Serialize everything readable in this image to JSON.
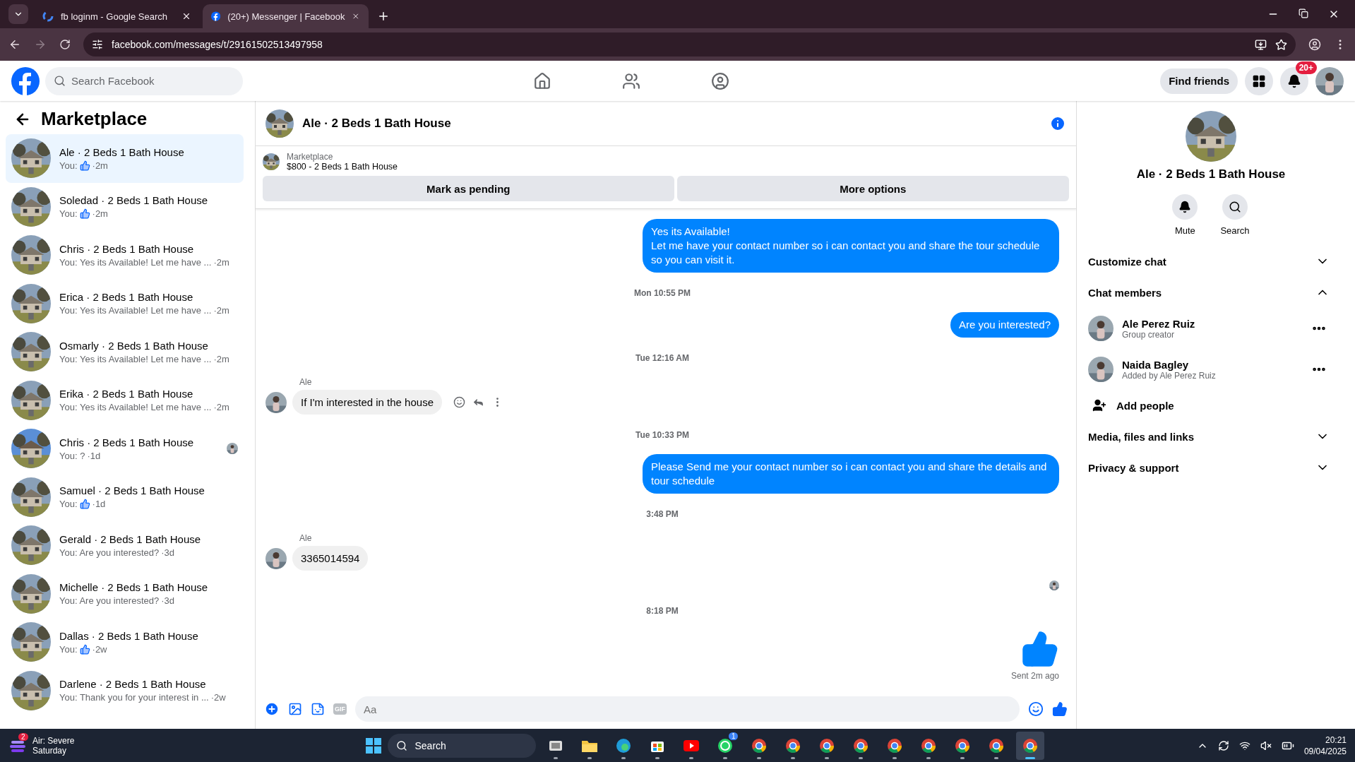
{
  "browser": {
    "tabs": [
      {
        "title": "fb loginm - Google Search",
        "selected": false
      },
      {
        "title": "(20+) Messenger | Facebook",
        "selected": true
      }
    ],
    "url": "facebook.com/messages/t/29161502513497958"
  },
  "header": {
    "search_placeholder": "Search Facebook",
    "find_friends": "Find friends",
    "notification_badge": "20+"
  },
  "sidebar": {
    "title": "Marketplace",
    "conversations": [
      {
        "name": "Ale · 2 Beds 1 Bath House",
        "preview": "You:",
        "kind": "like",
        "time": "·2m",
        "selected": true,
        "seen_avatar": false
      },
      {
        "name": "Soledad · 2 Beds 1 Bath House",
        "preview": "You:",
        "kind": "like",
        "time": "·2m",
        "selected": false,
        "seen_avatar": false
      },
      {
        "name": "Chris · 2 Beds 1 Bath House",
        "preview": "You: Yes its Available! Let me have ...",
        "kind": "text",
        "time": "·2m",
        "selected": false,
        "seen_avatar": false
      },
      {
        "name": "Erica · 2 Beds 1 Bath House",
        "preview": "You: Yes its Available! Let me have ...",
        "kind": "text",
        "time": "·2m",
        "selected": false,
        "seen_avatar": false
      },
      {
        "name": "Osmarly · 2 Beds 1 Bath House",
        "preview": "You: Yes its Available! Let me have ...",
        "kind": "text",
        "time": "·2m",
        "selected": false,
        "seen_avatar": false
      },
      {
        "name": "Erika · 2 Beds 1 Bath House",
        "preview": "You: Yes its Available! Let me have ...",
        "kind": "text",
        "time": "·2m",
        "selected": false,
        "seen_avatar": false
      },
      {
        "name": "Chris · 2 Beds 1 Bath House",
        "preview": "You: ?",
        "kind": "text",
        "time": "·1d",
        "selected": false,
        "seen_avatar": true
      },
      {
        "name": "Samuel · 2 Beds 1 Bath House",
        "preview": "You:",
        "kind": "like",
        "time": "·1d",
        "selected": false,
        "seen_avatar": false
      },
      {
        "name": "Gerald · 2 Beds 1 Bath House",
        "preview": "You: Are you interested?",
        "kind": "text",
        "time": "·3d",
        "selected": false,
        "seen_avatar": false
      },
      {
        "name": "Michelle · 2 Beds 1 Bath House",
        "preview": "You: Are you interested?",
        "kind": "text",
        "time": "·3d",
        "selected": false,
        "seen_avatar": false
      },
      {
        "name": "Dallas · 2 Beds 1 Bath House",
        "preview": "You:",
        "kind": "like",
        "time": "·2w",
        "selected": false,
        "seen_avatar": false
      },
      {
        "name": "Darlene · 2 Beds 1 Bath House",
        "preview": "You: Thank you for your interest in ...",
        "kind": "text",
        "time": "·2w",
        "selected": false,
        "seen_avatar": false
      }
    ]
  },
  "chat": {
    "title": "Ale · 2 Beds 1 Bath House",
    "listing": {
      "label": "Marketplace",
      "item": "$800 - 2 Beds 1 Bath House"
    },
    "buttons": [
      "Mark as pending",
      "More options"
    ],
    "messages": [
      {
        "kind": "outgoing",
        "text": "Yes its Available!\nLet me have your contact number so i can contact you and share the tour schedule so you can visit it."
      },
      {
        "kind": "timestamp",
        "text": "Mon 10:55 PM"
      },
      {
        "kind": "outgoing",
        "text": "Are you interested?"
      },
      {
        "kind": "timestamp",
        "text": "Tue 12:16 AM"
      },
      {
        "kind": "incoming",
        "sender": "Ale",
        "text": "If I'm interested in the house",
        "hover": true
      },
      {
        "kind": "timestamp",
        "text": "Tue 10:33 PM"
      },
      {
        "kind": "outgoing",
        "text": "Please Send me your contact number so i can contact you and share the details and tour schedule"
      },
      {
        "kind": "timestamp",
        "text": "3:48 PM"
      },
      {
        "kind": "incoming",
        "sender": "Ale",
        "text": "3365014594",
        "hover": false
      },
      {
        "kind": "seen"
      },
      {
        "kind": "timestamp",
        "text": "8:18 PM"
      },
      {
        "kind": "like",
        "status": "Sent 2m ago"
      }
    ],
    "composer": {
      "placeholder": "Aa",
      "gif": "GIF"
    }
  },
  "details": {
    "name": "Ale · 2 Beds 1 Bath House",
    "actions": [
      {
        "label": "Mute",
        "kind": "bell"
      },
      {
        "label": "Search",
        "kind": "search"
      }
    ],
    "sections": [
      {
        "title": "Customize chat",
        "expanded": false
      },
      {
        "title": "Chat members",
        "expanded": true,
        "members": [
          {
            "name": "Ale Perez Ruiz",
            "role": "Group creator"
          },
          {
            "name": "Naida Bagley",
            "role": "Added by Ale Perez Ruiz"
          }
        ],
        "add": "Add people"
      },
      {
        "title": "Media, files and links",
        "expanded": false
      },
      {
        "title": "Privacy & support",
        "expanded": false
      }
    ]
  },
  "taskbar": {
    "weather": {
      "title": "Air: Severe",
      "subtitle": "Saturday",
      "badge": "2"
    },
    "search": "Search",
    "apps": [
      {
        "kind": "taskview",
        "active": false
      },
      {
        "kind": "files",
        "active": false
      },
      {
        "kind": "edge",
        "active": false
      },
      {
        "kind": "store",
        "active": false
      },
      {
        "kind": "youtube",
        "active": false
      },
      {
        "kind": "whatsapp",
        "active": false,
        "badge": "1"
      },
      {
        "kind": "chrome",
        "active": false
      },
      {
        "kind": "chrome",
        "active": false
      },
      {
        "kind": "chrome",
        "active": false
      },
      {
        "kind": "chrome",
        "active": false
      },
      {
        "kind": "chrome",
        "active": false
      },
      {
        "kind": "chrome",
        "active": false
      },
      {
        "kind": "chrome",
        "active": false
      },
      {
        "kind": "chrome",
        "active": false
      },
      {
        "kind": "chrome",
        "active": true
      }
    ],
    "time": "20:21",
    "date": "09/04/2025"
  }
}
